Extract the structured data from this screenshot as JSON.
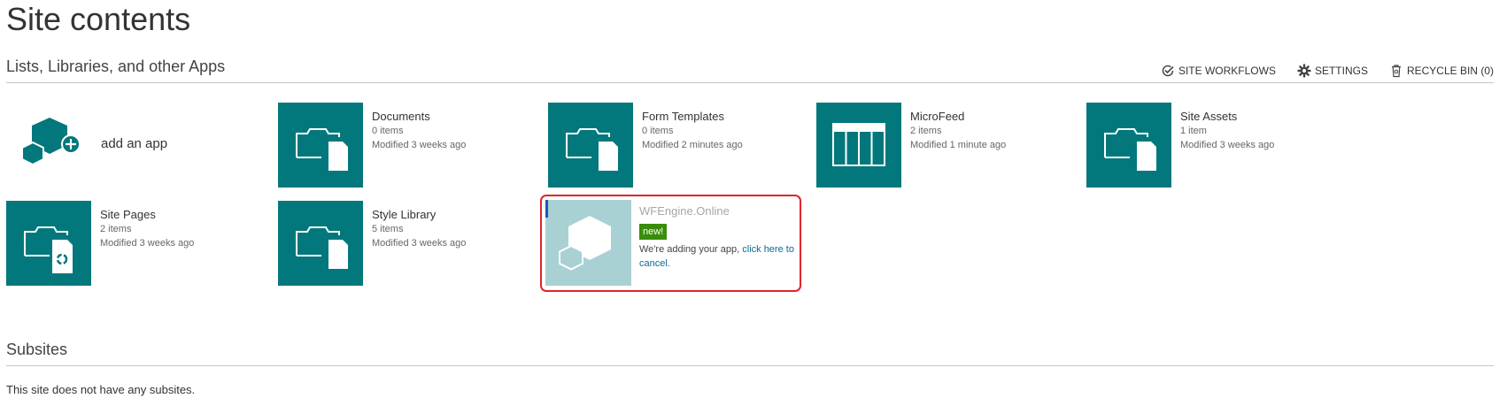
{
  "page": {
    "title": "Site contents"
  },
  "apps_section": {
    "title": "Lists, Libraries, and other Apps",
    "actions": [
      {
        "label": "SITE WORKFLOWS",
        "icon": "workflow-check-icon"
      },
      {
        "label": "SETTINGS",
        "icon": "gear-icon"
      },
      {
        "label": "RECYCLE BIN (0)",
        "icon": "recycle-bin-icon"
      }
    ]
  },
  "add_app": {
    "label": "add an app"
  },
  "tiles": [
    {
      "name": "Documents",
      "count": "0 items",
      "modified": "Modified 3 weeks ago",
      "icon": "document-library-icon"
    },
    {
      "name": "Form Templates",
      "count": "0 items",
      "modified": "Modified 2 minutes ago",
      "icon": "document-library-icon"
    },
    {
      "name": "MicroFeed",
      "count": "2 items",
      "modified": "Modified 1 minute ago",
      "icon": "list-icon"
    },
    {
      "name": "Site Assets",
      "count": "1 item",
      "modified": "Modified 3 weeks ago",
      "icon": "document-library-icon"
    },
    {
      "name": "Site Pages",
      "count": "2 items",
      "modified": "Modified 3 weeks ago",
      "icon": "wiki-library-icon"
    },
    {
      "name": "Style Library",
      "count": "5 items",
      "modified": "Modified 3 weeks ago",
      "icon": "document-library-icon"
    }
  ],
  "pending_app": {
    "name": "WFEngine.Online",
    "badge": "new!",
    "message": "We're adding your app, ",
    "cancel_link": "click here to cancel",
    "message_end": ".",
    "icon": "app-hexagon-icon"
  },
  "subsites_section": {
    "title": "Subsites",
    "empty_message": "This site does not have any subsites."
  },
  "colors": {
    "tile_teal": "#03787c",
    "pending_tile": "#a9d1d3",
    "badge_green": "#3a8d0a",
    "highlight_red": "#e0242c",
    "link_blue": "#0b6a9a"
  }
}
